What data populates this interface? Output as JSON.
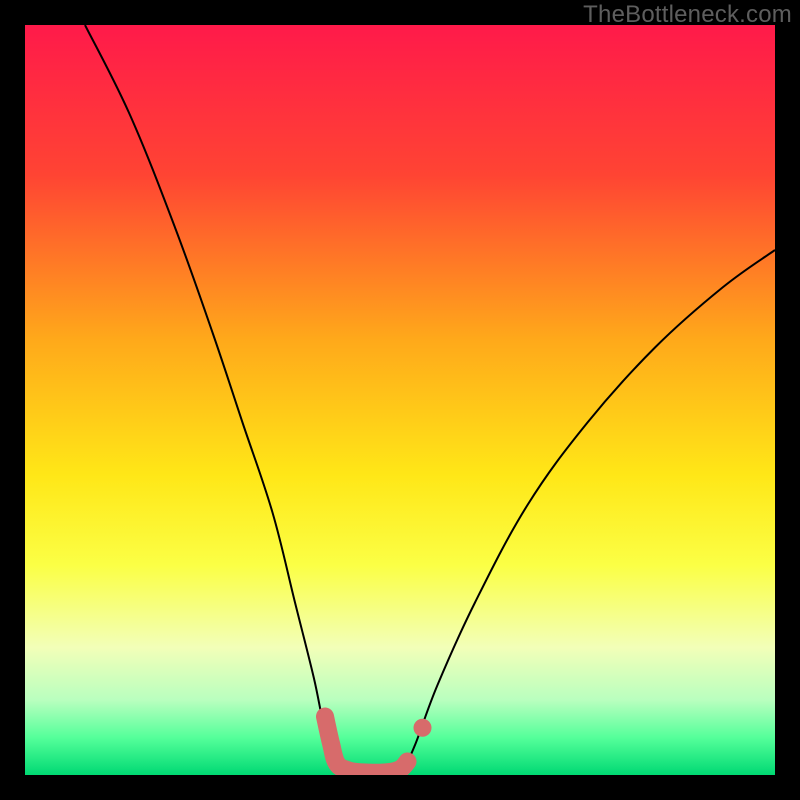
{
  "watermark": "TheBottleneck.com",
  "chart_data": {
    "type": "line",
    "title": "",
    "xlabel": "",
    "ylabel": "",
    "xlim": [
      0,
      100
    ],
    "ylim": [
      0,
      100
    ],
    "note": "x = position along plot width (percent); y = bottleneck percentage (0 bottom, 100 top)",
    "background_gradient": {
      "stops": [
        {
          "pos": 0.0,
          "color": "#ff1a4a"
        },
        {
          "pos": 0.2,
          "color": "#ff4433"
        },
        {
          "pos": 0.42,
          "color": "#ffa91a"
        },
        {
          "pos": 0.6,
          "color": "#ffe717"
        },
        {
          "pos": 0.72,
          "color": "#fbff45"
        },
        {
          "pos": 0.83,
          "color": "#f2ffb8"
        },
        {
          "pos": 0.9,
          "color": "#b9ffbf"
        },
        {
          "pos": 0.95,
          "color": "#55ff9a"
        },
        {
          "pos": 1.0,
          "color": "#00d973"
        }
      ]
    },
    "main_curve": [
      {
        "x": 8,
        "y": 100
      },
      {
        "x": 14,
        "y": 88
      },
      {
        "x": 20,
        "y": 73
      },
      {
        "x": 25,
        "y": 59
      },
      {
        "x": 29,
        "y": 47
      },
      {
        "x": 33,
        "y": 35
      },
      {
        "x": 36,
        "y": 23
      },
      {
        "x": 38.5,
        "y": 13
      },
      {
        "x": 40,
        "y": 6
      },
      {
        "x": 41.8,
        "y": 1.2
      },
      {
        "x": 45,
        "y": 0.3
      },
      {
        "x": 48.5,
        "y": 0.3
      },
      {
        "x": 50.5,
        "y": 1.2
      },
      {
        "x": 52,
        "y": 4
      },
      {
        "x": 55,
        "y": 12
      },
      {
        "x": 60,
        "y": 23
      },
      {
        "x": 67,
        "y": 36
      },
      {
        "x": 75,
        "y": 47
      },
      {
        "x": 84,
        "y": 57
      },
      {
        "x": 93,
        "y": 65
      },
      {
        "x": 100,
        "y": 70
      }
    ],
    "highlight_segment": [
      {
        "x": 40.0,
        "y": 7.8
      },
      {
        "x": 40.8,
        "y": 4.2
      },
      {
        "x": 41.6,
        "y": 1.5
      },
      {
        "x": 43.2,
        "y": 0.6
      },
      {
        "x": 45.0,
        "y": 0.35
      },
      {
        "x": 47.0,
        "y": 0.3
      },
      {
        "x": 49.0,
        "y": 0.45
      },
      {
        "x": 50.2,
        "y": 0.9
      },
      {
        "x": 51.0,
        "y": 1.8
      }
    ],
    "highlight_point": {
      "x": 53.0,
      "y": 6.3
    }
  }
}
